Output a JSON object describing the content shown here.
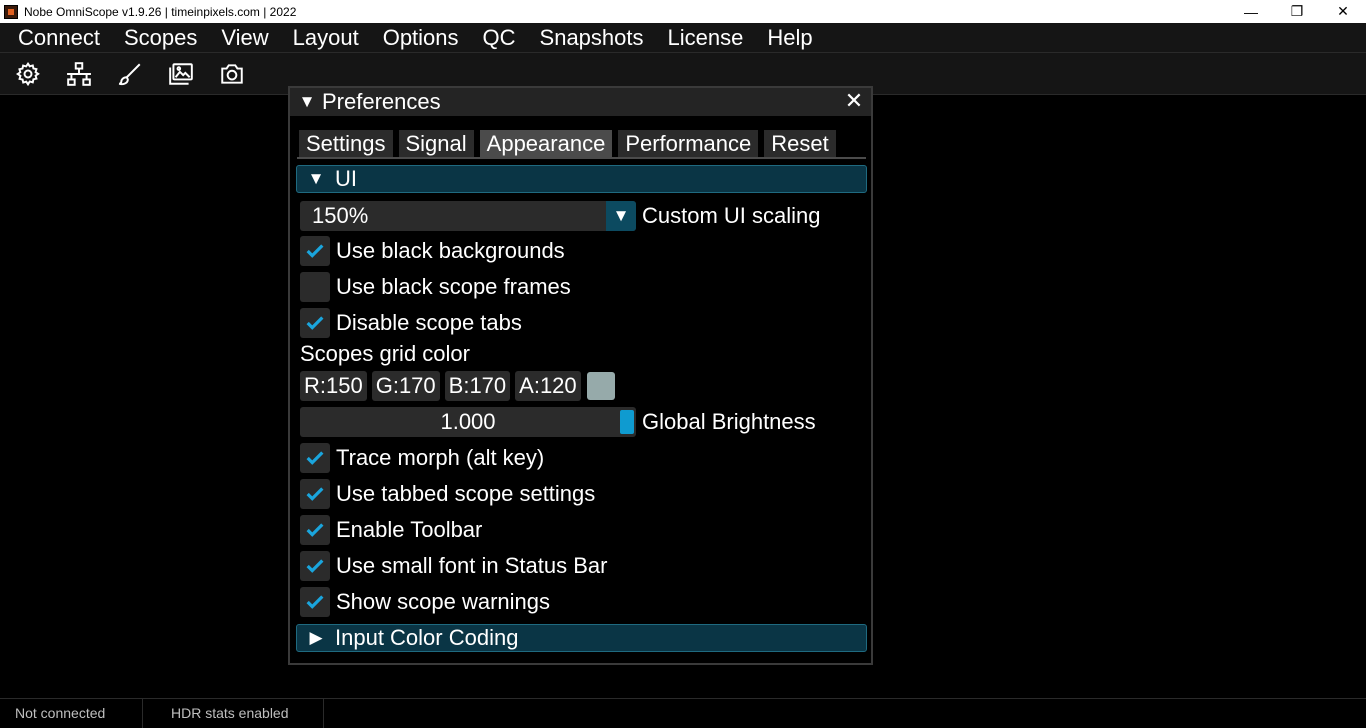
{
  "window": {
    "title": "Nobe OmniScope v1.9.26 | timeinpixels.com | 2022",
    "minimize_glyph": "—",
    "restore_glyph": "❐",
    "close_glyph": "✕"
  },
  "menu": [
    "Connect",
    "Scopes",
    "View",
    "Layout",
    "Options",
    "QC",
    "Snapshots",
    "License",
    "Help"
  ],
  "toolbar": {
    "icons": [
      "gear-icon",
      "network-icon",
      "brush-icon",
      "images-icon",
      "camera-icon"
    ]
  },
  "preferences": {
    "title": "Preferences",
    "close_glyph": "✕",
    "tabs": [
      "Settings",
      "Signal",
      "Appearance",
      "Performance",
      "Reset"
    ],
    "active_tab": "Appearance",
    "ui_section": {
      "title": "UI",
      "scaling_value": "150%",
      "scaling_label": "Custom UI scaling",
      "use_black_backgrounds": {
        "label": "Use black backgrounds",
        "checked": true
      },
      "use_black_scope_frames": {
        "label": "Use black scope frames",
        "checked": false
      },
      "disable_scope_tabs": {
        "label": "Disable scope tabs",
        "checked": true
      },
      "grid_color_label": "Scopes grid color",
      "grid_color": {
        "r": "R:150",
        "g": "G:170",
        "b": "B:170",
        "a": "A:120",
        "swatch": "#96aaaa"
      },
      "brightness_value": "1.000",
      "brightness_label": "Global Brightness",
      "trace_morph": {
        "label": "Trace morph (alt key)",
        "checked": true
      },
      "tabbed_scope_settings": {
        "label": "Use tabbed scope settings",
        "checked": true
      },
      "enable_toolbar": {
        "label": "Enable Toolbar",
        "checked": true
      },
      "small_font_status_bar": {
        "label": "Use small font in Status Bar",
        "checked": true
      },
      "show_scope_warnings": {
        "label": "Show scope warnings",
        "checked": true
      }
    },
    "input_color_section": {
      "title": "Input Color Coding"
    }
  },
  "status": {
    "connection": "Not connected",
    "hdr": "HDR stats enabled"
  },
  "colors": {
    "accent": "#0f9bd0",
    "section_bg": "#0a3545",
    "check": "#1aa5dd"
  }
}
